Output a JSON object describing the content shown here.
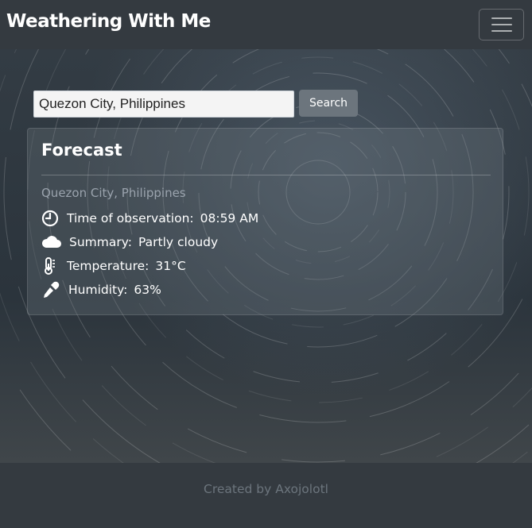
{
  "navbar": {
    "brand": "Weathering With Me",
    "toggler_icon": "hamburger-menu-icon"
  },
  "search": {
    "value": "Quezon City, Philippines",
    "button_label": "Search"
  },
  "forecast": {
    "title": "Forecast",
    "location": "Quezon City, Philippines",
    "rows": [
      {
        "icon": "clock-icon",
        "label": "Time of observation:",
        "value": "08:59 AM"
      },
      {
        "icon": "cloud-icon",
        "label": "Summary:",
        "value": "Partly cloudy"
      },
      {
        "icon": "thermometer-icon",
        "label": "Temperature:",
        "value": "31°C"
      },
      {
        "icon": "eyedropper-icon",
        "label": "Humidity:",
        "value": "63%"
      }
    ]
  },
  "footer": {
    "text": "Created by Axojolotl"
  },
  "colors": {
    "navbar_bg": "#343a40",
    "button_bg": "#6c757d",
    "muted_text": "#6c757d",
    "location_text": "#9aa3ad"
  }
}
